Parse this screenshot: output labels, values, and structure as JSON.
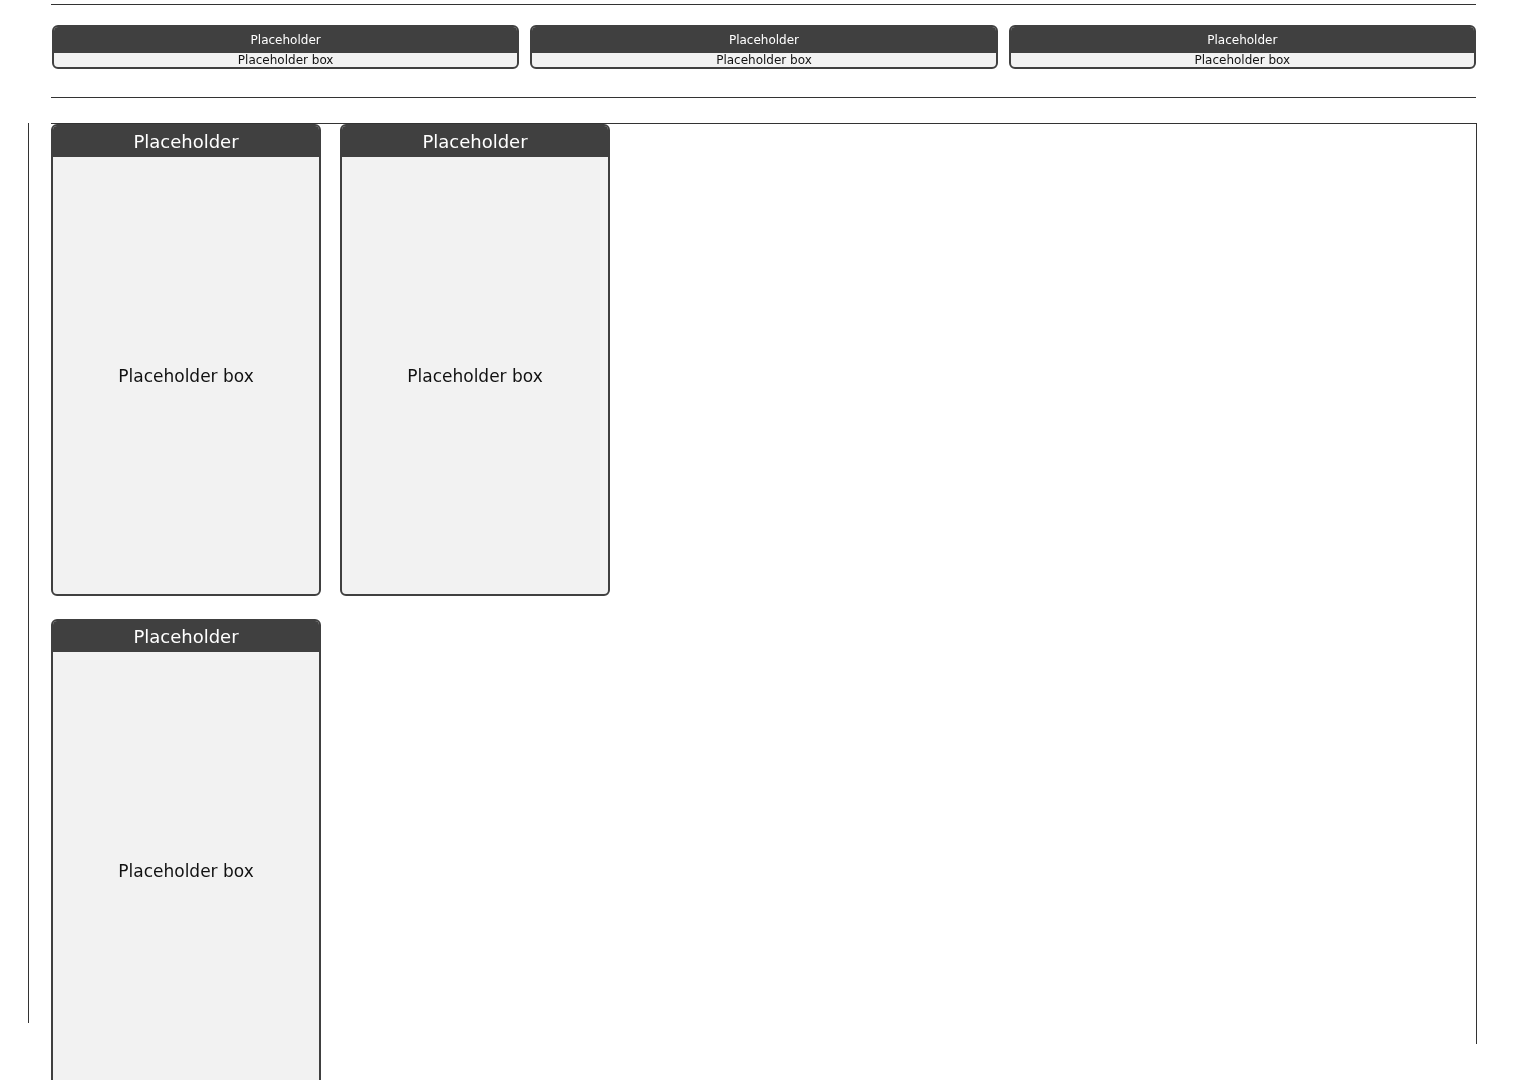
{
  "top_cards": [
    {
      "title": "Placeholder",
      "body": "Placeholder box"
    },
    {
      "title": "Placeholder",
      "body": "Placeholder box"
    },
    {
      "title": "Placeholder",
      "body": "Placeholder box"
    }
  ],
  "main_cards": [
    {
      "title": "Placeholder",
      "body": "Placeholder box"
    },
    {
      "title": "Placeholder",
      "body": "Placeholder box"
    },
    {
      "title": "Placeholder",
      "body": "Placeholder box"
    }
  ]
}
